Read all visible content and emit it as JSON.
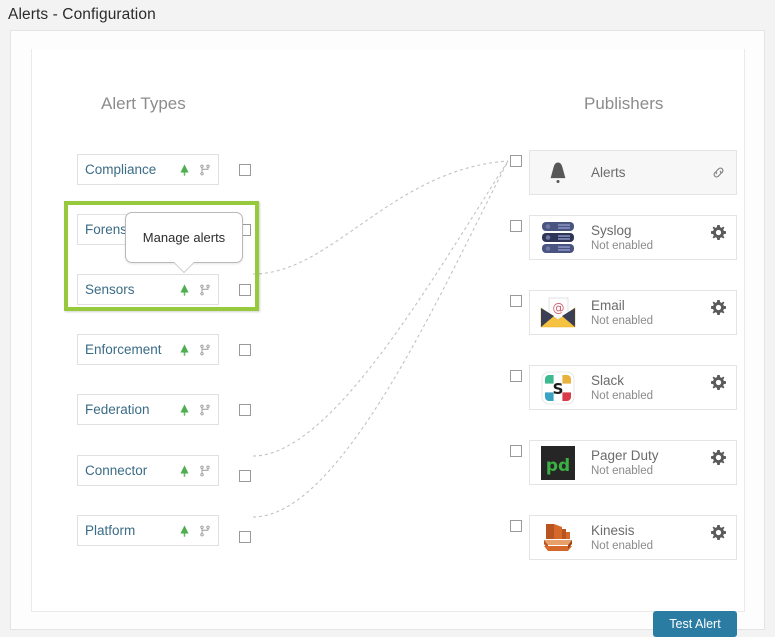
{
  "window": {
    "title": "Alerts - Configuration"
  },
  "colors": {
    "accent_green": "#97c93d",
    "bell_green": "#4fae4f",
    "link_blue": "#3b6c86",
    "button_blue": "#2b7ca3",
    "syslog_navy": "#3f4a73",
    "kinesis_orange": "#c2581f",
    "pagerduty_green": "#3bb143"
  },
  "columns": {
    "alert_types_heading": "Alert Types",
    "publishers_heading": "Publishers"
  },
  "alert_types": [
    {
      "label": "Compliance",
      "bell_icon": "bell-icon",
      "fork_icon": "fork-icon",
      "checkbox_checked": false,
      "connected": false
    },
    {
      "label": "Forensics",
      "bell_icon": "bell-icon",
      "fork_icon": "fork-icon",
      "checkbox_checked": false,
      "connected": false
    },
    {
      "label": "Sensors",
      "bell_icon": "bell-icon",
      "fork_icon": "fork-icon",
      "checkbox_checked": false,
      "connected": true
    },
    {
      "label": "Enforcement",
      "bell_icon": "bell-icon",
      "fork_icon": "fork-icon",
      "checkbox_checked": false,
      "connected": false
    },
    {
      "label": "Federation",
      "bell_icon": "bell-icon",
      "fork_icon": "fork-icon",
      "checkbox_checked": false,
      "connected": false
    },
    {
      "label": "Connector",
      "bell_icon": "bell-icon",
      "fork_icon": "fork-icon",
      "checkbox_checked": false,
      "connected": true
    },
    {
      "label": "Platform",
      "bell_icon": "bell-icon",
      "fork_icon": "fork-icon",
      "checkbox_checked": false,
      "connected": true
    }
  ],
  "publishers": [
    {
      "name": "Alerts",
      "status": "",
      "icon": "bell-icon",
      "action_icon": "link-icon",
      "checkbox_checked": false
    },
    {
      "name": "Syslog",
      "status": "Not enabled",
      "icon": "server-icon",
      "action_icon": "gear-icon",
      "checkbox_checked": false
    },
    {
      "name": "Email",
      "status": "Not enabled",
      "icon": "envelope-icon",
      "action_icon": "gear-icon",
      "checkbox_checked": false
    },
    {
      "name": "Slack",
      "status": "Not enabled",
      "icon": "slack-icon",
      "action_icon": "gear-icon",
      "checkbox_checked": false
    },
    {
      "name": "Pager Duty",
      "status": "Not enabled",
      "icon": "pagerduty-icon",
      "action_icon": "gear-icon",
      "checkbox_checked": false
    },
    {
      "name": "Kinesis",
      "status": "Not enabled",
      "icon": "kinesis-icon",
      "action_icon": "gear-icon",
      "checkbox_checked": false
    }
  ],
  "tooltip": {
    "text": "Manage alerts"
  },
  "footer": {
    "test_alert_label": "Test Alert"
  }
}
